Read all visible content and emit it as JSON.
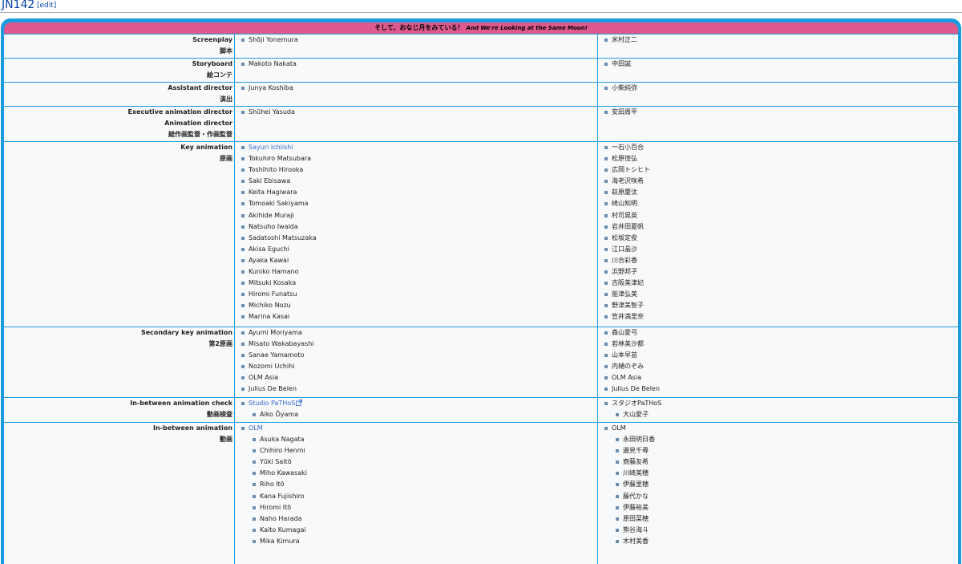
{
  "heading": {
    "title": "JN142",
    "edit": "[edit]"
  },
  "banner": {
    "title_ja": "そして、おなじ月をみている！",
    "title_en": "And We're Looking at the Same Moon!"
  },
  "rows": [
    {
      "labels": [
        "Screenplay",
        "脚本"
      ],
      "left": [
        "Shōji Yonemura"
      ],
      "right": [
        "米村正二"
      ]
    },
    {
      "labels": [
        "Storyboard",
        "絵コンテ"
      ],
      "left": [
        "Makoto Nakata"
      ],
      "right": [
        "中田誠"
      ]
    },
    {
      "labels": [
        "Assistant director",
        "演出"
      ],
      "left": [
        "Junya Koshiba"
      ],
      "right": [
        "小柴純弥"
      ]
    },
    {
      "labels": [
        "Executive animation director",
        "Animation director",
        "総作画監督・作画監督"
      ],
      "left": [
        "Shūhei Yasuda"
      ],
      "right": [
        "安田周平"
      ]
    },
    {
      "labels": [
        "Key animation",
        "原画"
      ],
      "left": [
        "Sayuri Ichiishi",
        "Tokuhiro Matsubara",
        "Toshihito Hirooka",
        "Saki Ebisawa",
        "Keita Hagiwara",
        "Tomoaki Sakiyama",
        "Akihide Muraji",
        "Natsuho Iwaida",
        "Sadatoshi Matsuzaka",
        "Akisa Eguchi",
        "Ayaka Kawai",
        "Kuniko Hamano",
        "Mitsuki Kosaka",
        "Hiromi Funatsu",
        "Michiko Nozu",
        "Marina Kasai"
      ],
      "right": [
        "一石小百合",
        "松原徳弘",
        "広岡トシヒト",
        "海老沢咲希",
        "萩原慶汰",
        "崎山知明",
        "村司晃英",
        "岩井田夏帆",
        "松坂定俊",
        "江口晶沙",
        "川合彩香",
        "浜野邦子",
        "古阪美津妃",
        "船津弘美",
        "野津美智子",
        "笠井満里奈"
      ]
    },
    {
      "labels": [
        "Secondary key animation",
        "第2原画"
      ],
      "left": [
        "Ayumi Moriyama",
        "Misato Wakabayashi",
        "Sanae Yamamoto",
        "Nozomi Uchihi",
        "OLM Asia",
        "Julius De Belen"
      ],
      "right": [
        "森山愛弓",
        "若林美沙都",
        "山本早苗",
        "内樋のぞみ",
        "OLM Asia",
        "Julius De Belen"
      ]
    },
    {
      "labels": [
        "In-between animation check",
        "動画検査"
      ],
      "left": [
        "Studio PaTHoS",
        "Aiko Ōyama"
      ],
      "right": [
        "スタジオPaTHoS",
        "大山愛子"
      ]
    },
    {
      "labels": [
        "In-between animation",
        "動画"
      ],
      "left": [
        "OLM",
        "Asuka Nagata",
        "Chihiro Henmi",
        "Yūki Saitō",
        "Miho Kawasaki",
        "Riho Itō",
        "Kana Fujishiro",
        "Hiromi Itō",
        "Naho Harada",
        "Kaito Kumagai",
        "Mika Kimura"
      ],
      "right": [
        "OLM",
        "永田明日香",
        "邊見千尋",
        "齋藤友希",
        "川崎美穂",
        "伊藤里穂",
        "藤代かな",
        "伊藤裕美",
        "原田菜穂",
        "熊谷海斗",
        "木村美香"
      ]
    }
  ]
}
